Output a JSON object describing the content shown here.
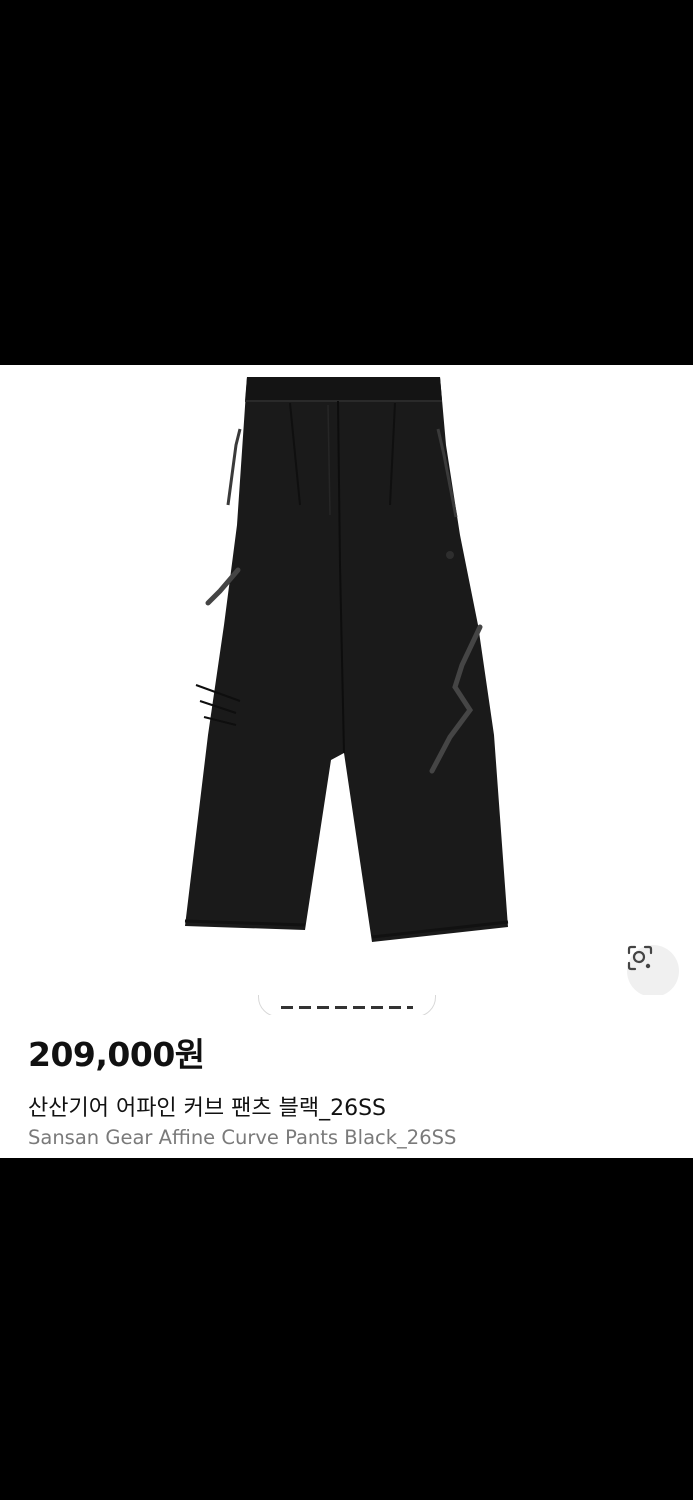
{
  "product": {
    "image_alt": "Sansan Gear Affine Curve Pants Black",
    "price": "209,000원",
    "title_ko": "산산기어 어파인 커브 팬츠 블랙_26SS",
    "title_en": "Sansan Gear Affine Curve Pants Black_26SS",
    "chip_label": "",
    "lens_icon": "visual-search-icon"
  },
  "colors": {
    "background": "#000000",
    "card": "#ffffff",
    "price_text": "#111111",
    "subtitle_text": "#7a7a7a",
    "garment": "#1a1a1a"
  }
}
